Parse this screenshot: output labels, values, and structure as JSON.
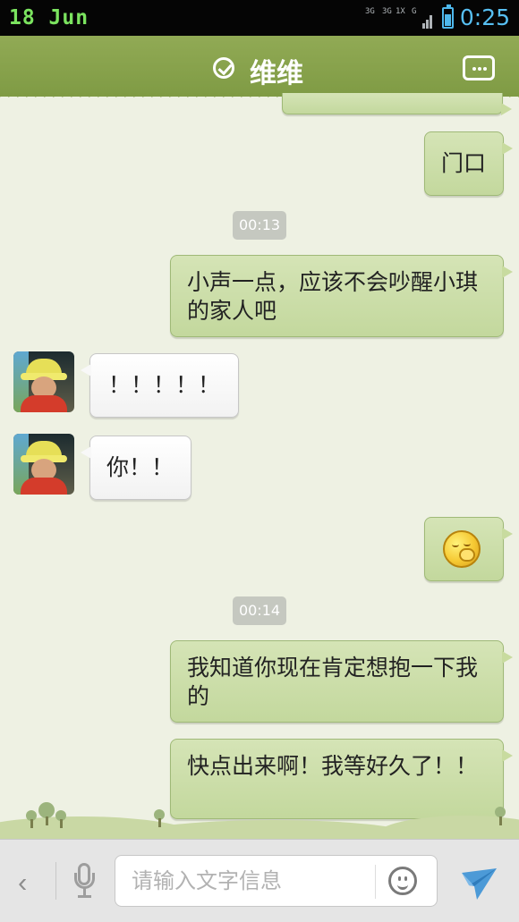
{
  "status_bar": {
    "date": "18 Jun",
    "network_labels": [
      "3G",
      "3G",
      "1X",
      "G"
    ],
    "time": "0:25",
    "colors": {
      "date": "#7be35f",
      "time": "#57bff2"
    }
  },
  "header": {
    "title": "维维",
    "verified_icon": "check-circle-icon",
    "menu_icon": "more-options-icon"
  },
  "messages": [
    {
      "side": "mine",
      "text": "门口"
    },
    {
      "type": "timestamp",
      "text": "00:13"
    },
    {
      "side": "mine",
      "text": "小声一点，应该不会吵醒小琪的家人吧"
    },
    {
      "side": "theirs",
      "text": "！！！！！"
    },
    {
      "side": "theirs",
      "text": "你！！"
    },
    {
      "side": "mine",
      "emoji": "smiling-face-hand-icon"
    },
    {
      "type": "timestamp",
      "text": "00:14"
    },
    {
      "side": "mine",
      "text": "我知道你现在肯定想抱一下我的"
    },
    {
      "side": "mine",
      "text": "快点出来啊！我等好久了！！"
    }
  ],
  "input_bar": {
    "back_icon": "chevron-left-icon",
    "voice_icon": "microphone-icon",
    "placeholder": "请输入文字信息",
    "emoji_icon": "smiley-icon",
    "send_icon": "send-arrow-icon"
  },
  "colors": {
    "header": "#86a14a",
    "sent_bubble": "#c8db9f",
    "received_bubble": "#ffffff",
    "chat_background": "#eef1e3",
    "send_icon": "#4c9ad7"
  }
}
